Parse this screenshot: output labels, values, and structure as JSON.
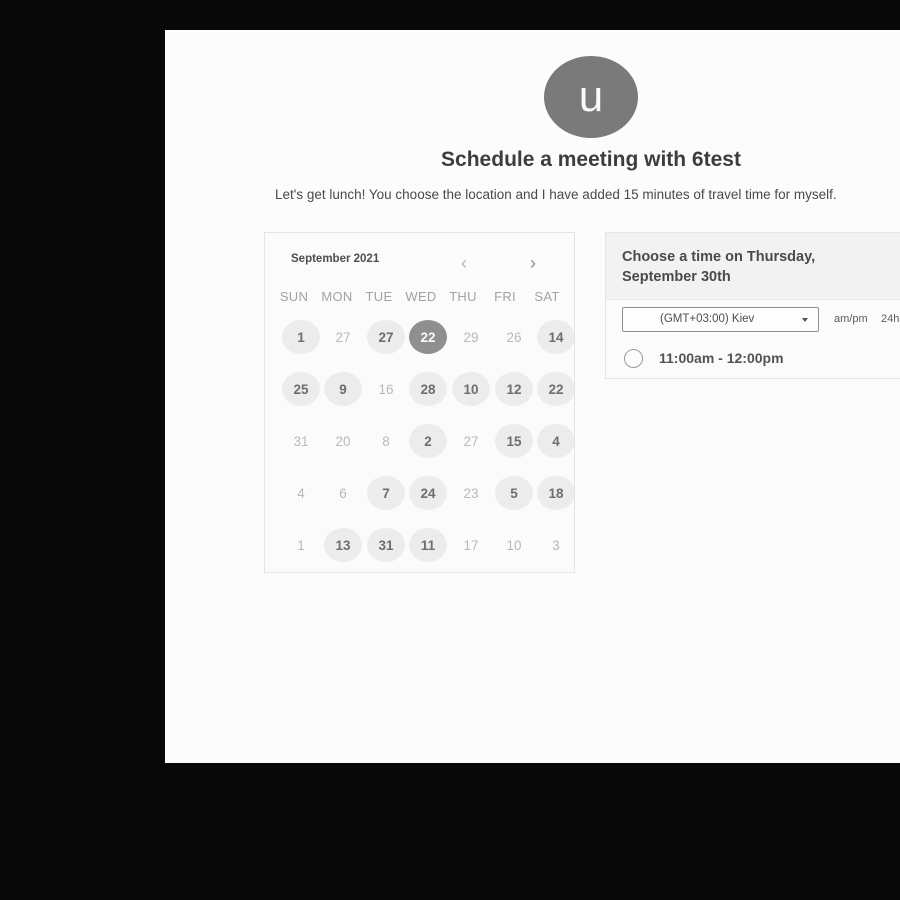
{
  "avatar": {
    "letter": "u"
  },
  "heading": {
    "title": "Schedule a meeting with 6test"
  },
  "description": "Let's get lunch! You choose the location and I have added 15 minutes of travel time for myself.",
  "calendar": {
    "month_label": "September 2021",
    "prev_icon": "chevron-left-icon",
    "next_icon": "chevron-right-icon",
    "prev_glyph": "‹",
    "next_glyph": "›",
    "weekdays": [
      "SUN",
      "MON",
      "TUE",
      "WED",
      "THU",
      "FRI",
      "SAT"
    ],
    "weeks": [
      [
        {
          "label": "1",
          "state": "available"
        },
        {
          "label": "27",
          "state": "disabled"
        },
        {
          "label": "27",
          "state": "available"
        },
        {
          "label": "22",
          "state": "selected"
        },
        {
          "label": "29",
          "state": "disabled"
        },
        {
          "label": "26",
          "state": "disabled"
        },
        {
          "label": "14",
          "state": "available"
        }
      ],
      [
        {
          "label": "25",
          "state": "available"
        },
        {
          "label": "9",
          "state": "available"
        },
        {
          "label": "16",
          "state": "disabled"
        },
        {
          "label": "28",
          "state": "available"
        },
        {
          "label": "10",
          "state": "available"
        },
        {
          "label": "12",
          "state": "available"
        },
        {
          "label": "22",
          "state": "available"
        }
      ],
      [
        {
          "label": "31",
          "state": "disabled"
        },
        {
          "label": "20",
          "state": "disabled"
        },
        {
          "label": "8",
          "state": "disabled"
        },
        {
          "label": "2",
          "state": "available"
        },
        {
          "label": "27",
          "state": "disabled"
        },
        {
          "label": "15",
          "state": "available"
        },
        {
          "label": "4",
          "state": "available"
        }
      ],
      [
        {
          "label": "4",
          "state": "disabled"
        },
        {
          "label": "6",
          "state": "disabled"
        },
        {
          "label": "7",
          "state": "available"
        },
        {
          "label": "24",
          "state": "available"
        },
        {
          "label": "23",
          "state": "disabled"
        },
        {
          "label": "5",
          "state": "available"
        },
        {
          "label": "18",
          "state": "available"
        }
      ],
      [
        {
          "label": "1",
          "state": "disabled"
        },
        {
          "label": "13",
          "state": "available"
        },
        {
          "label": "31",
          "state": "available"
        },
        {
          "label": "11",
          "state": "available"
        },
        {
          "label": "17",
          "state": "disabled"
        },
        {
          "label": "10",
          "state": "disabled"
        },
        {
          "label": "3",
          "state": "disabled"
        }
      ]
    ]
  },
  "time_panel": {
    "heading": "Choose a time on Thursday, September 30th",
    "timezone": {
      "value": "(GMT+03:00) Kiev",
      "icon": "chevron-down-icon"
    },
    "format_ampm": "am/pm",
    "format_24h": "24h",
    "slots": [
      {
        "label": "11:00am - 12:00pm"
      }
    ]
  }
}
